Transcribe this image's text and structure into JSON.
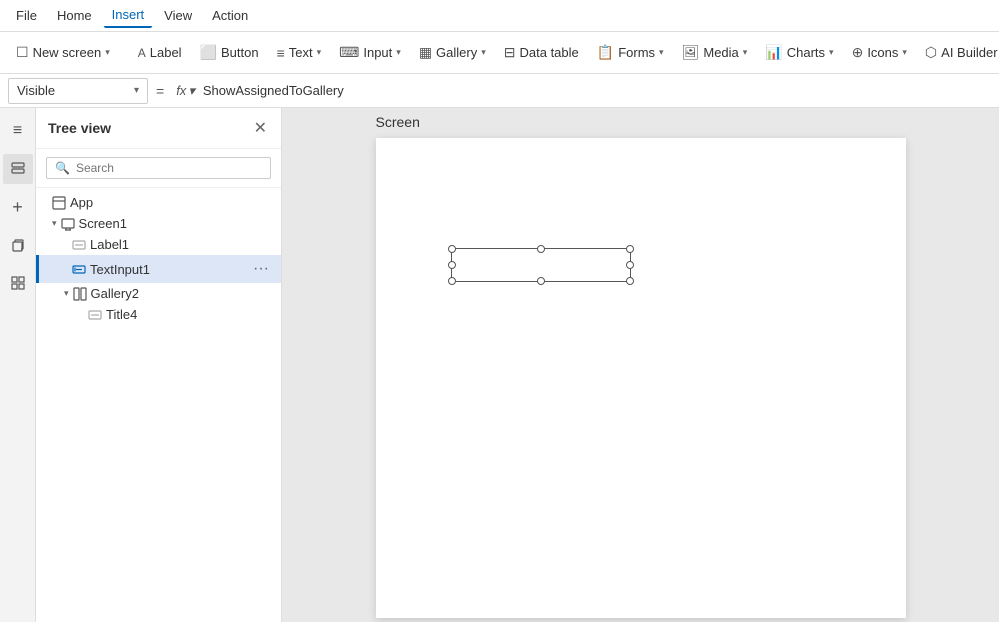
{
  "menu": {
    "items": [
      {
        "label": "File",
        "active": false
      },
      {
        "label": "Home",
        "active": false
      },
      {
        "label": "Insert",
        "active": true
      },
      {
        "label": "View",
        "active": false
      },
      {
        "label": "Action",
        "active": false
      }
    ]
  },
  "toolbar": {
    "new_screen_label": "New screen",
    "label_label": "Label",
    "button_label": "Button",
    "text_label": "Text",
    "input_label": "Input",
    "gallery_label": "Gallery",
    "data_table_label": "Data table",
    "forms_label": "Forms",
    "media_label": "Media",
    "charts_label": "Charts",
    "icons_label": "Icons",
    "ai_builder_label": "AI Builder"
  },
  "formula_bar": {
    "property": "Visible",
    "fx_label": "fx",
    "formula": "ShowAssignedToGallery"
  },
  "tree_view": {
    "title": "Tree view",
    "search_placeholder": "Search",
    "items": [
      {
        "id": "app",
        "label": "App",
        "level": 0,
        "icon": "app",
        "has_chevron": false,
        "expanded": false
      },
      {
        "id": "screen1",
        "label": "Screen1",
        "level": 0,
        "icon": "screen",
        "has_chevron": true,
        "expanded": true
      },
      {
        "id": "label1",
        "label": "Label1",
        "level": 1,
        "icon": "label",
        "has_chevron": false,
        "expanded": false
      },
      {
        "id": "textinput1",
        "label": "TextInput1",
        "level": 1,
        "icon": "textinput",
        "has_chevron": false,
        "expanded": false,
        "selected": true
      },
      {
        "id": "gallery2",
        "label": "Gallery2",
        "level": 1,
        "icon": "gallery",
        "has_chevron": true,
        "expanded": true
      },
      {
        "id": "title4",
        "label": "Title4",
        "level": 2,
        "icon": "label",
        "has_chevron": false,
        "expanded": false
      }
    ]
  },
  "sidebar_icons": [
    {
      "name": "hamburger-icon",
      "symbol": "≡"
    },
    {
      "name": "layers-icon",
      "symbol": "⧉"
    },
    {
      "name": "plus-icon",
      "symbol": "+"
    },
    {
      "name": "copy-icon",
      "symbol": "❑"
    },
    {
      "name": "component-icon",
      "symbol": "⊞"
    }
  ],
  "canvas": {
    "screen_label": "Screen"
  }
}
